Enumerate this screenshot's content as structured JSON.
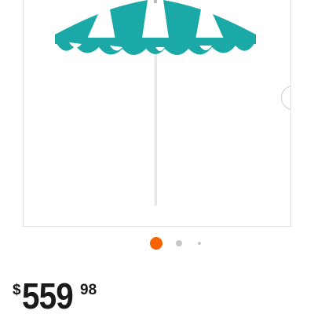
{
  "product": {
    "image_icon": "patio-umbrella-image",
    "canopy_colors": [
      "#1aa9a7",
      "#ffffff"
    ],
    "pole_color": "#e8e8e8"
  },
  "gallery": {
    "next_icon": "chevron-right-icon",
    "dot_count": 3,
    "active_index": 0,
    "dot_colors": {
      "active": "#f96302",
      "inactive": "#c8c8c8"
    }
  },
  "price": {
    "currency": "$",
    "dollars": "559",
    "cents": "98"
  }
}
